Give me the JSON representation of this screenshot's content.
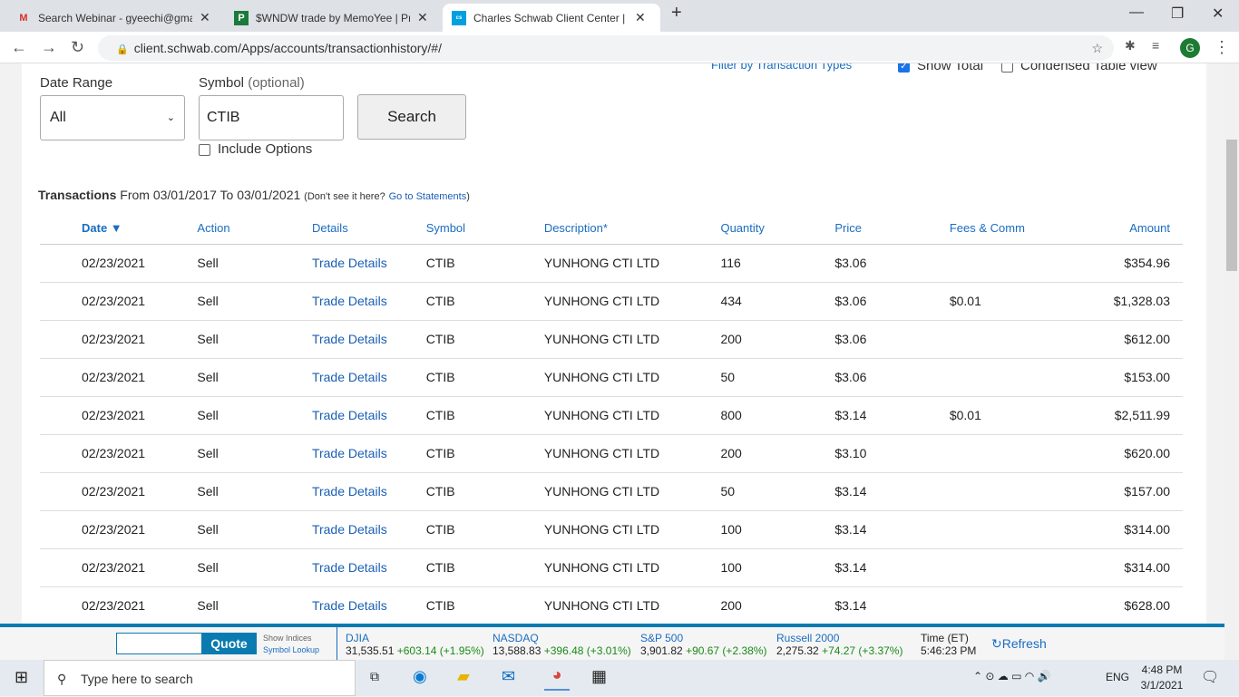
{
  "browser": {
    "tabs": [
      {
        "title": "Search Webinar - gyeechi@gmail",
        "icon": "gmail-icon"
      },
      {
        "title": "$WNDW trade by MemoYee | Pro",
        "icon": "p-icon"
      },
      {
        "title": "Charles Schwab Client Center | Ac",
        "icon": "schwab-icon"
      }
    ],
    "url": "client.schwab.com/Apps/accounts/transactionhistory/#/",
    "avatar": "G"
  },
  "filters": {
    "date_range_label": "Date Range",
    "date_range_value": "All",
    "symbol_label": "Symbol",
    "symbol_optional": "(optional)",
    "symbol_value": "CTIB",
    "search": "Search",
    "include_options": "Include Options",
    "filter_types": "Filter by Transaction Types",
    "show_total": "Show Total",
    "condensed": "Condensed Table view"
  },
  "summary": {
    "title": "Transactions",
    "range": "From 03/01/2017 To 03/01/2021",
    "note": "(Don't see it here?",
    "link": "Go to Statements",
    ")": ")"
  },
  "columns": [
    "Date ▼",
    "Action",
    "Details",
    "Symbol",
    "Description*",
    "Quantity",
    "Price",
    "Fees & Comm",
    "Amount"
  ],
  "rows": [
    [
      "02/23/2021",
      "Sell",
      "Trade Details",
      "CTIB",
      "YUNHONG CTI LTD",
      "116",
      "$3.06",
      "",
      "$354.96"
    ],
    [
      "02/23/2021",
      "Sell",
      "Trade Details",
      "CTIB",
      "YUNHONG CTI LTD",
      "434",
      "$3.06",
      "$0.01",
      "$1,328.03"
    ],
    [
      "02/23/2021",
      "Sell",
      "Trade Details",
      "CTIB",
      "YUNHONG CTI LTD",
      "200",
      "$3.06",
      "",
      "$612.00"
    ],
    [
      "02/23/2021",
      "Sell",
      "Trade Details",
      "CTIB",
      "YUNHONG CTI LTD",
      "50",
      "$3.06",
      "",
      "$153.00"
    ],
    [
      "02/23/2021",
      "Sell",
      "Trade Details",
      "CTIB",
      "YUNHONG CTI LTD",
      "800",
      "$3.14",
      "$0.01",
      "$2,511.99"
    ],
    [
      "02/23/2021",
      "Sell",
      "Trade Details",
      "CTIB",
      "YUNHONG CTI LTD",
      "200",
      "$3.10",
      "",
      "$620.00"
    ],
    [
      "02/23/2021",
      "Sell",
      "Trade Details",
      "CTIB",
      "YUNHONG CTI LTD",
      "50",
      "$3.14",
      "",
      "$157.00"
    ],
    [
      "02/23/2021",
      "Sell",
      "Trade Details",
      "CTIB",
      "YUNHONG CTI LTD",
      "100",
      "$3.14",
      "",
      "$314.00"
    ],
    [
      "02/23/2021",
      "Sell",
      "Trade Details",
      "CTIB",
      "YUNHONG CTI LTD",
      "100",
      "$3.14",
      "",
      "$314.00"
    ],
    [
      "02/23/2021",
      "Sell",
      "Trade Details",
      "CTIB",
      "YUNHONG CTI LTD",
      "200",
      "$3.14",
      "",
      "$628.00"
    ]
  ],
  "ticker": {
    "quote": "Quote",
    "show_indices": "Show Indices",
    "symbol_lookup": "Symbol Lookup",
    "indices": [
      {
        "name": "DJIA",
        "value": "31,535.51",
        "change": "+603.14 (+1.95%)"
      },
      {
        "name": "NASDAQ",
        "value": "13,588.83",
        "change": "+396.48 (+3.01%)"
      },
      {
        "name": "S&P 500",
        "value": "3,901.82",
        "change": "+90.67 (+2.38%)"
      },
      {
        "name": "Russell 2000",
        "value": "2,275.32",
        "change": "+74.27 (+3.37%)"
      }
    ],
    "time_label": "Time (ET)",
    "time": "5:46:23 PM",
    "refresh": "Refresh"
  },
  "taskbar": {
    "search": "Type here to search",
    "lang": "ENG",
    "time": "4:48 PM",
    "date": "3/1/2021"
  }
}
